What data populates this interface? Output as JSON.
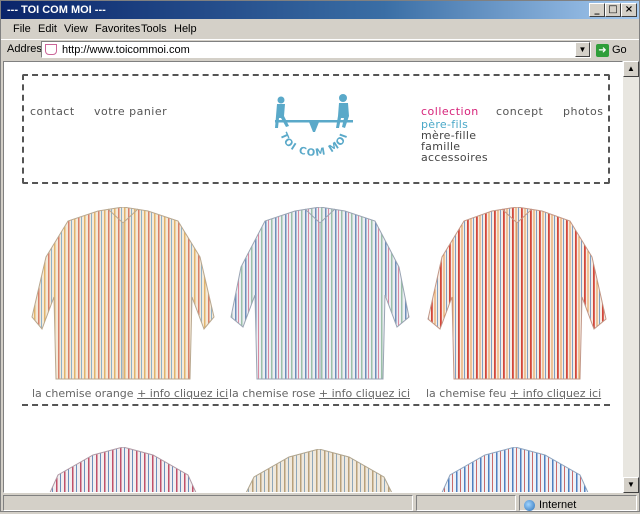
{
  "window": {
    "title": "--- TOI COM MOI ---"
  },
  "menu": [
    "File",
    "Edit",
    "View",
    "Favorites",
    "Tools",
    "Help"
  ],
  "address": {
    "label": "Address",
    "url": "http://www.toicommoi.com",
    "go_label": "Go"
  },
  "site": {
    "nav_left": [
      "contact",
      "votre panier"
    ],
    "logo_text": "TOI COM MOI",
    "nav_right": [
      "collection",
      "concept",
      "photos"
    ],
    "sub_menu": [
      "père-fils",
      "mère-fille",
      "famille",
      "accessoires"
    ],
    "products": [
      {
        "name": "la chemise orange",
        "link": "+ info cliquez ici"
      },
      {
        "name": "la chemise rose",
        "link": "+ info cliquez ici"
      },
      {
        "name": "la chemise feu",
        "link": "+ info cliquez ici"
      }
    ]
  },
  "status": {
    "zone": "Internet"
  },
  "colors": {
    "accent": "#d6237a",
    "sub_active": "#4aa8c8",
    "logo": "#5aa9c9"
  }
}
